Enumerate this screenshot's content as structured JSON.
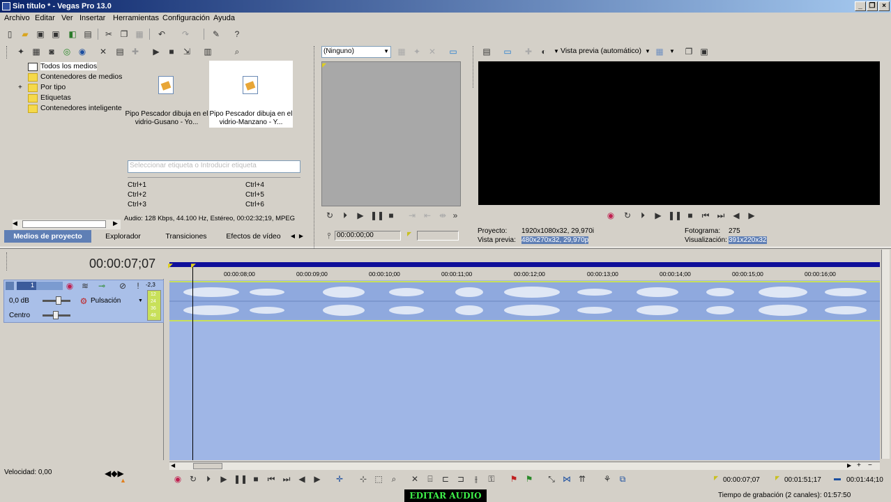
{
  "window": {
    "title": "Sin título * - Vegas Pro 13.0"
  },
  "menu": [
    "Archivo",
    "Editar",
    "Ver",
    "Insertar",
    "Herramientas",
    "Configuración",
    "Ayuda"
  ],
  "media": {
    "tree": [
      "Todos los medios",
      "Contenedores de medios",
      "Por tipo",
      "Etiquetas",
      "Contenedores inteligente"
    ],
    "items": [
      {
        "label": "Pipo Pescador dibuja en el vidrio-Gusano - Yo..."
      },
      {
        "label": "Pipo Pescador dibuja en el vidrio-Manzano - Y..."
      }
    ],
    "search_placeholder": "Seleccionar etiqueta o Introducir etiqueta",
    "shortcuts": [
      "Ctrl+1",
      "Ctrl+2",
      "Ctrl+3",
      "Ctrl+4",
      "Ctrl+5",
      "Ctrl+6"
    ],
    "info": "Audio: 128 Kbps, 44.100 Hz, Estéreo, 00:02:32;19, MPEG"
  },
  "tabs": [
    "Medios de proyecto",
    "Explorador",
    "Transiciones",
    "Efectos de vídeo"
  ],
  "trimmer": {
    "dropdown": "(Ninguno)",
    "timecode": "00:00:00;00"
  },
  "preview": {
    "mode": "Vista previa (automático)",
    "proyecto_label": "Proyecto:",
    "proyecto_value": "1920x1080x32, 29,970i",
    "vista_label": "Vista previa:",
    "vista_value": "480x270x32, 29,970p",
    "fotograma_label": "Fotograma:",
    "fotograma_value": "275",
    "visualizacion_label": "Visualización:",
    "visualizacion_value": "391x220x32"
  },
  "timeline": {
    "timecode": "00:00:07;07",
    "ruler": [
      "00:00:08;00",
      "00:00:09;00",
      "00:00:10;00",
      "00:00:11;00",
      "00:00:12;00",
      "00:00:13;00",
      "00:00:14;00",
      "00:00:15;00",
      "00:00:16;00"
    ]
  },
  "track": {
    "number": "1",
    "volume": "0,0 dB",
    "pan": "Centro",
    "mode": "Pulsación",
    "meter_top": "-2,3",
    "meter_labels": [
      "12",
      "24",
      "36",
      "48"
    ]
  },
  "velocity": "Velocidad: 0,00",
  "bottom_times": [
    "00:00:07;07",
    "00:01:51;17",
    "00:01:44;10"
  ],
  "status": {
    "record_time": "Tiempo de grabación (2 canales): 01:57:50"
  },
  "badge": "EDITAR AUDIO"
}
